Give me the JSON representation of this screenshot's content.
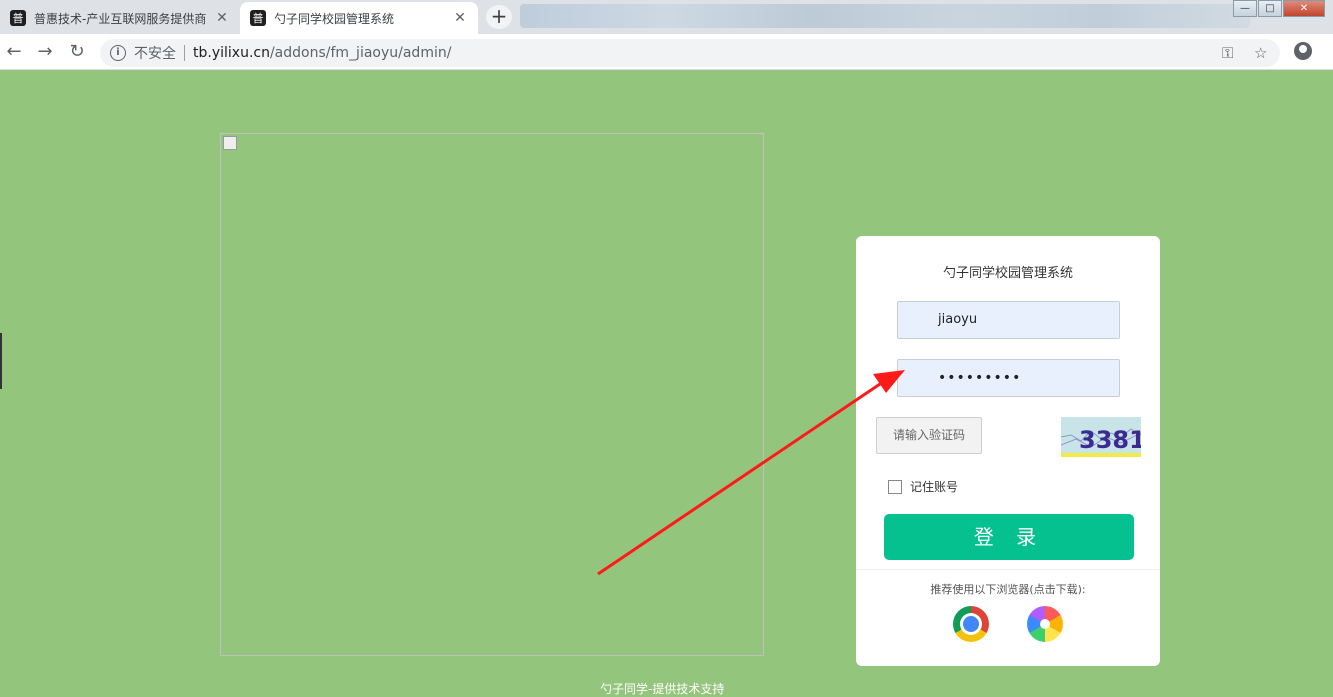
{
  "browser": {
    "tabs": [
      {
        "favicon": "普",
        "title": "普惠技术-产业互联网服务提供商",
        "active": false
      },
      {
        "favicon": "普",
        "title": "勺子同学校园管理系统",
        "active": true
      }
    ],
    "new_tab_label": "+",
    "window_controls": {
      "minimize": "—",
      "maximize": "□",
      "close": "✕"
    },
    "security_label": "不安全",
    "url_host": "tb.yilixu.cn",
    "url_path": "/addons/fm_jiaoyu/admin/"
  },
  "login": {
    "title": "勺子同学校园管理系统",
    "username_value": "jiaoyu",
    "password_value": "•••••••••",
    "captcha_placeholder": "请输入验证码",
    "captcha_text": "3381",
    "remember_label": "记住账号",
    "submit_label": "登 录",
    "browser_tip": "推荐使用以下浏览器(点击下载):",
    "browser_icons": [
      "chrome-icon",
      "pinwheel-browser-icon"
    ]
  },
  "footer": {
    "text": "勺子同学-提供技术支持"
  },
  "colors": {
    "page_background": "#94c57c",
    "login_button": "#05c08f",
    "annotation_arrow": "#ff1a1a"
  }
}
